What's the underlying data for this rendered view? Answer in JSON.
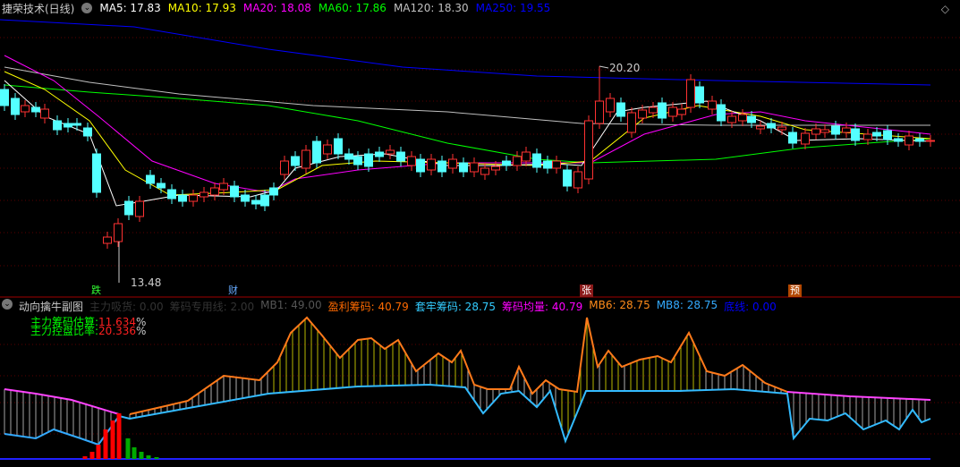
{
  "main": {
    "title": "捷荣技术(日线)",
    "ma": [
      {
        "label": "MA5: 17.83",
        "color": "#ffffff"
      },
      {
        "label": "MA10: 17.93",
        "color": "#ffff00"
      },
      {
        "label": "MA20: 18.08",
        "color": "#ff00ff"
      },
      {
        "label": "MA60: 17.86",
        "color": "#00ff00"
      },
      {
        "label": "MA120: 18.30",
        "color": "#c0c0c0"
      },
      {
        "label": "MA250: 19.55",
        "color": "#0000ff"
      }
    ],
    "high_label": "20.20",
    "low_label": "13.48",
    "tags": [
      "跌",
      "财",
      "张",
      "预"
    ]
  },
  "sub": {
    "title": "动向擒牛副图",
    "items": [
      {
        "label": "主力吸货: 0.00",
        "color": "#333333"
      },
      {
        "label": "筹码专用线: 2.00",
        "color": "#333333"
      },
      {
        "label": "MB1: 49.00",
        "color": "#555555"
      },
      {
        "label": "盈利筹码: 40.79",
        "color": "#ff6a00"
      },
      {
        "label": "套牢筹码: 28.75",
        "color": "#33ccff"
      },
      {
        "label": "筹码均量: 40.79",
        "color": "#ff00ff"
      },
      {
        "label": "MB6: 28.75",
        "color": "#ff8c1a"
      },
      {
        "label": "MB8: 28.75",
        "color": "#33aaff"
      },
      {
        "label": "底线: 0.00",
        "color": "#0000ff"
      }
    ],
    "est1_label": "主力筹码估算:",
    "est1_value": "11.634",
    "est2_label": "主力控盘比率:",
    "est2_value": "20.336",
    "pct": "%"
  }
}
